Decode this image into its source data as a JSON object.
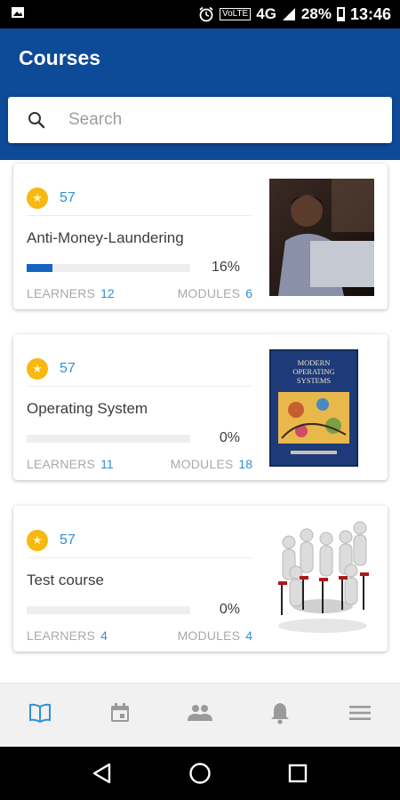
{
  "status_bar": {
    "network": "4G",
    "volte": "VoLTE",
    "battery": "28%",
    "time": "13:46"
  },
  "app_bar": {
    "title": "Courses"
  },
  "search": {
    "placeholder": "Search",
    "value": ""
  },
  "courses": [
    {
      "points": "57",
      "title": "Anti-Money-Laundering",
      "progress_text": "16%",
      "progress_fraction": 0.16,
      "learners_label": "LEARNERS",
      "learners": "12",
      "modules_label": "MODULES",
      "modules": "6",
      "thumbnail": "person-at-laptop-photo"
    },
    {
      "points": "57",
      "title": "Operating System",
      "progress_text": "0%",
      "progress_fraction": 0,
      "learners_label": "LEARNERS",
      "learners": "11",
      "modules_label": "MODULES",
      "modules": "18",
      "thumbnail": "book-cover",
      "book_cover_title": "MODERN OPERATING SYSTEMS"
    },
    {
      "points": "57",
      "title": "Test course",
      "progress_text": "0%",
      "progress_fraction": 0,
      "learners_label": "LEARNERS",
      "learners": "4",
      "modules_label": "MODULES",
      "modules": "4",
      "thumbnail": "figures-meeting-illustration"
    }
  ],
  "bottom_nav": [
    {
      "icon": "book-icon",
      "active": true
    },
    {
      "icon": "calendar-icon",
      "active": false
    },
    {
      "icon": "people-icon",
      "active": false
    },
    {
      "icon": "bell-icon",
      "active": false
    },
    {
      "icon": "menu-icon",
      "active": false
    }
  ],
  "colors": {
    "app_bar": "#0d4a98",
    "accent": "#2e8fd8",
    "progress": "#1565c0",
    "star": "#f7b90f",
    "nav_active": "#2e8fd8",
    "nav_inactive": "#9a9a9a"
  }
}
